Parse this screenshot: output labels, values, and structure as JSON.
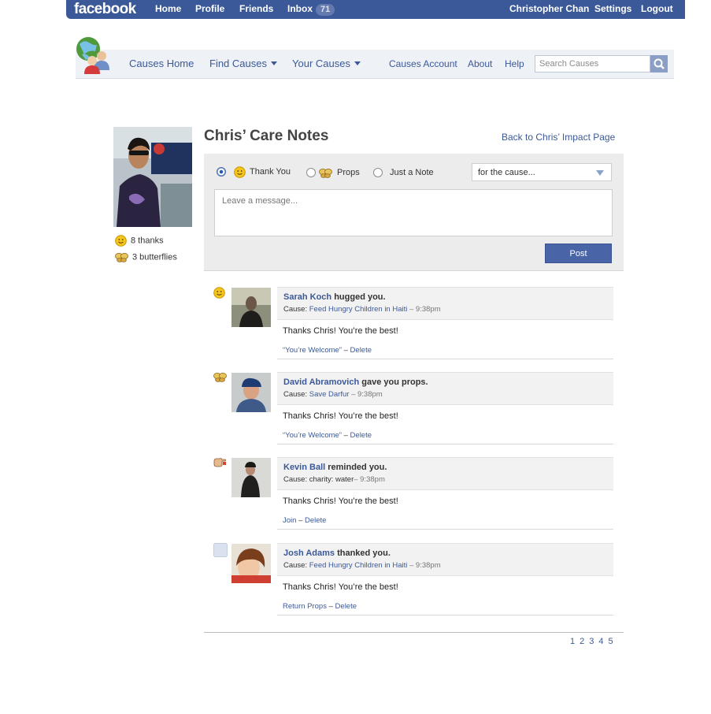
{
  "topbar": {
    "logo": "facebook",
    "nav": [
      "Home",
      "Profile",
      "Friends",
      "Inbox"
    ],
    "inbox_count": "71",
    "user_name": "Christopher Chan",
    "settings": "Settings",
    "logout": "Logout"
  },
  "causes_nav": {
    "home": "Causes Home",
    "find": "Find Causes",
    "yours": "Your Causes",
    "account": "Causes Account",
    "about": "About",
    "help": "Help",
    "search_placeholder": "Search Causes"
  },
  "profile": {
    "thanks": "8 thanks",
    "butterflies": "3 butterflies"
  },
  "page": {
    "title": "Chris’ Care Notes",
    "back_link": "Back to Chris’ Impact Page"
  },
  "composer": {
    "options": [
      "Thank You",
      "Props",
      "Just a Note"
    ],
    "selected": "Thank You",
    "cause_select": "for the cause...",
    "message_placeholder": "Leave a message...",
    "post_label": "Post"
  },
  "notes": [
    {
      "icon": "smiley-icon",
      "name": "Sarah Koch",
      "action": "hugged you.",
      "cause_label": "Cause:",
      "cause": "Feed Hungry Children in Haiti",
      "time": " – 9:38pm",
      "message": "Thanks Chris! You’re the best!",
      "link1": "“You’re Welcome”",
      "sep": " – ",
      "link2": "Delete"
    },
    {
      "icon": "butterfly-icon",
      "name": "David Abramovich",
      "action": "gave you props.",
      "cause_label": "Cause:",
      "cause": "Save Darfur",
      "time": " – 9:38pm",
      "message": "Thanks Chris! You’re the best!",
      "link1": "“You’re Welcome”",
      "sep": " – ",
      "link2": "Delete"
    },
    {
      "icon": "pointing-hand-icon",
      "name": "Kevin Ball",
      "action": "reminded you.",
      "cause_label": "Cause:",
      "cause": "charity: water",
      "time": "– 9:38pm",
      "message": "Thanks Chris! You’re the best!",
      "link1": "Join",
      "sep": " – ",
      "link2": "Delete"
    },
    {
      "icon": "blank-square-icon",
      "name": "Josh Adams",
      "action": "thanked you.",
      "cause_label": "Cause:",
      "cause": "Feed Hungry Children in Haiti",
      "time": " – 9:38pm",
      "message": "Thanks Chris! You’re the best!",
      "link1": "Return Props",
      "sep": " – ",
      "link2": "Delete"
    }
  ],
  "pagination": [
    "1",
    "2",
    "3",
    "4",
    "5"
  ],
  "colors": {
    "facebook_blue": "#3b5998",
    "button_blue": "#4a64a8",
    "composer_gray": "#ececec"
  }
}
